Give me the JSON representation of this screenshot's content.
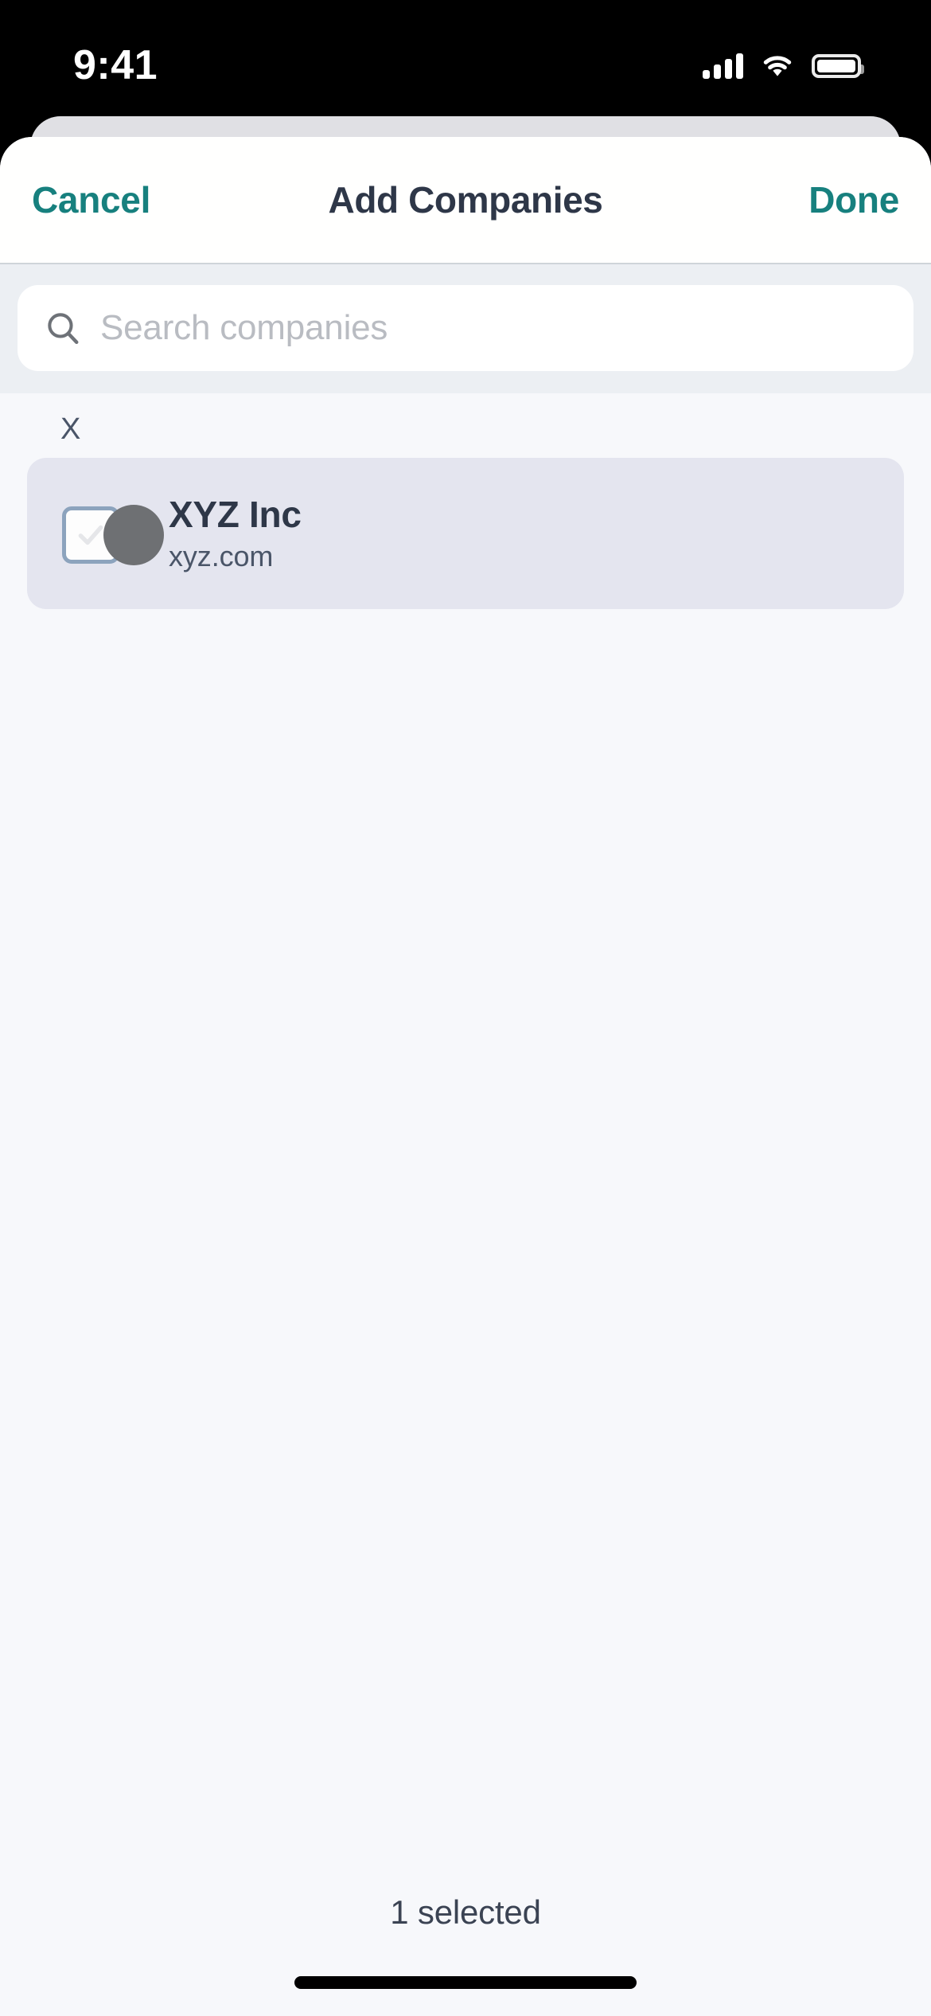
{
  "status_bar": {
    "time": "9:41",
    "cellular_icon": "cellular-signal-icon",
    "wifi_icon": "wifi-icon",
    "battery_icon": "battery-icon"
  },
  "navbar": {
    "cancel_label": "Cancel",
    "title": "Add Companies",
    "done_label": "Done"
  },
  "search": {
    "placeholder": "Search companies",
    "value": "",
    "icon": "search-icon"
  },
  "list": {
    "sections": [
      {
        "header": "X",
        "items": [
          {
            "name": "XYZ Inc",
            "domain": "xyz.com",
            "selected": true,
            "avatar_icon": "company-avatar-placeholder"
          }
        ]
      }
    ]
  },
  "footer": {
    "selected_count_label": "1 selected"
  },
  "colors": {
    "accent_teal": "#17807e",
    "title_slate": "#2e3748",
    "sheet_background": "#f7f8fb",
    "search_band": "#eceff3",
    "selected_row": "#e4e5ef",
    "checkbox_border": "#8ca3bd",
    "avatar_gray": "#6e7073"
  }
}
